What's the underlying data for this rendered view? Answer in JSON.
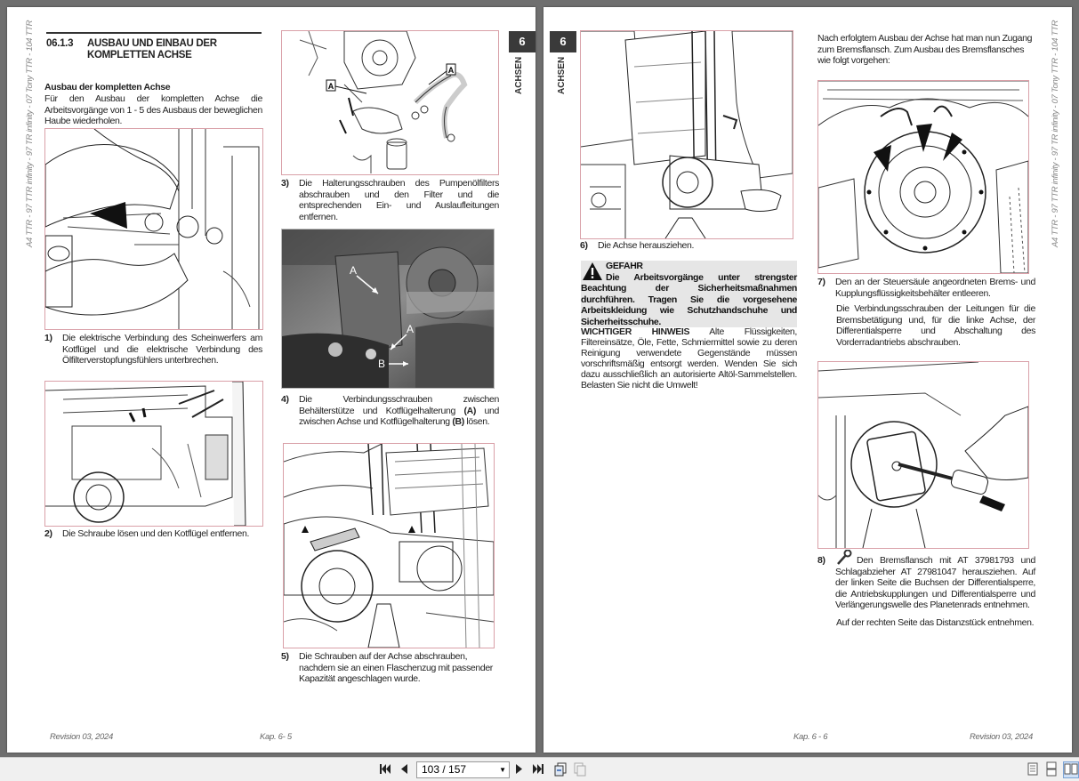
{
  "side_text": "A4 TTR - 97 TTR infinity - 97 TR infinity - 07 Tony TTR - 104 TTR",
  "left_page": {
    "section_number": "06.1.3",
    "section_title": "AUSBAU UND EINBAU DER KOMPLETTEN ACHSE",
    "subheading": "Ausbau der kompletten Achse",
    "intro": "Für den Ausbau der kompletten Achse die Arbeitsvorgänge von 1 - 5 des Ausbaus der beweglichen Haube wiederholen.",
    "tab_number": "6",
    "tab_label": "ACHSEN",
    "steps": [
      {
        "num": "1)",
        "text": "Die elektrische Verbindung des Scheinwerfers am Kotflügel und die elektrische Verbindung des Ölfilterverstopfungsfühlers unterbrechen."
      },
      {
        "num": "2)",
        "text": "Die Schraube lösen und den Kotflügel entfernen."
      },
      {
        "num": "3)",
        "text": "Die Halterungsschrauben des Pumpenölfilters abschrauben und den Filter und die entsprechenden Ein- und Auslaufleitungen entfernen."
      },
      {
        "num": "4)",
        "text_a": "Die Verbindungsschrauben zwischen Behälterstütze und Kotflügelhalterung ",
        "bold_a": "(A)",
        "text_b": " und zwischen Achse und Kotflügelhalterung ",
        "bold_b": "(B)",
        "text_c": " lösen."
      },
      {
        "num": "5)",
        "text": "Die Schrauben auf der Achse abschrauben, nachdem sie an einen Flaschenzug mit passender Kapazität angeschlagen wurde."
      }
    ],
    "fig3_labels": [
      "A",
      "A"
    ],
    "fig4_labels": [
      "A",
      "A",
      "B"
    ],
    "footer_left": "Revision 03, 2024",
    "footer_right": "Kap. 6- 5"
  },
  "right_page": {
    "tab_number": "6",
    "tab_label": "ACHSEN",
    "step6": {
      "num": "6)",
      "text": "Die Achse herausziehen."
    },
    "warning_title": "GEFAHR",
    "warning_text": "Die Arbeitsvorgänge unter strengster Beachtung der Sicherheitsmaßnahmen durchführen. Tragen Sie die vorgesehene Arbeitskleidung wie Schutzhandschuhe und Sicherheitsschuhe.",
    "hint_label": "WICHTIGER HINWEIS",
    "hint_text": " Alte Flüssigkeiten, Filtereinsätze, Öle, Fette, Schmiermittel sowie zu deren Reinigung verwendete Gegenstände müssen vorschriftsmäßig entsorgt werden. Wenden Sie sich dazu ausschließlich an autorisierte Altöl-Sammelstellen. Belasten Sie nicht die Umwelt!",
    "intro": "Nach erfolgtem Ausbau der Achse hat man nun Zugang zum Bremsflansch. Zum Ausbau des Bremsflansches wie folgt vorgehen:",
    "step7": {
      "num": "7)",
      "text": "Den an der Steuersäule angeordneten Brems- und Kupplungsflüssigkeitsbehälter entleeren.",
      "text2": "Die Verbindungsschrauben der Leitungen für die Bremsbetätigung und, für die linke Achse, der Differentialsperre und Abschaltung des Vorderradantriebs abschrauben."
    },
    "step8": {
      "num": "8)",
      "text": "Den Bremsflansch mit AT 37981793 und Schlagabzieher AT 27981047 herausziehen. Auf der linken Seite die Buchsen der Differentialsperre, die Antriebskupplungen und Differentialsperre und Verlängerungswelle des Planetenrads entnehmen.",
      "text2": "Auf der rechten Seite das Distanzstück entnehmen."
    },
    "footer_left": "Kap. 6 - 6",
    "footer_right": "Revision 03, 2024"
  },
  "toolbar": {
    "page_value": "103 / 157",
    "first_icon": "first-page-icon",
    "prev_icon": "prev-page-icon",
    "next_icon": "next-page-icon",
    "last_icon": "last-page-icon"
  }
}
